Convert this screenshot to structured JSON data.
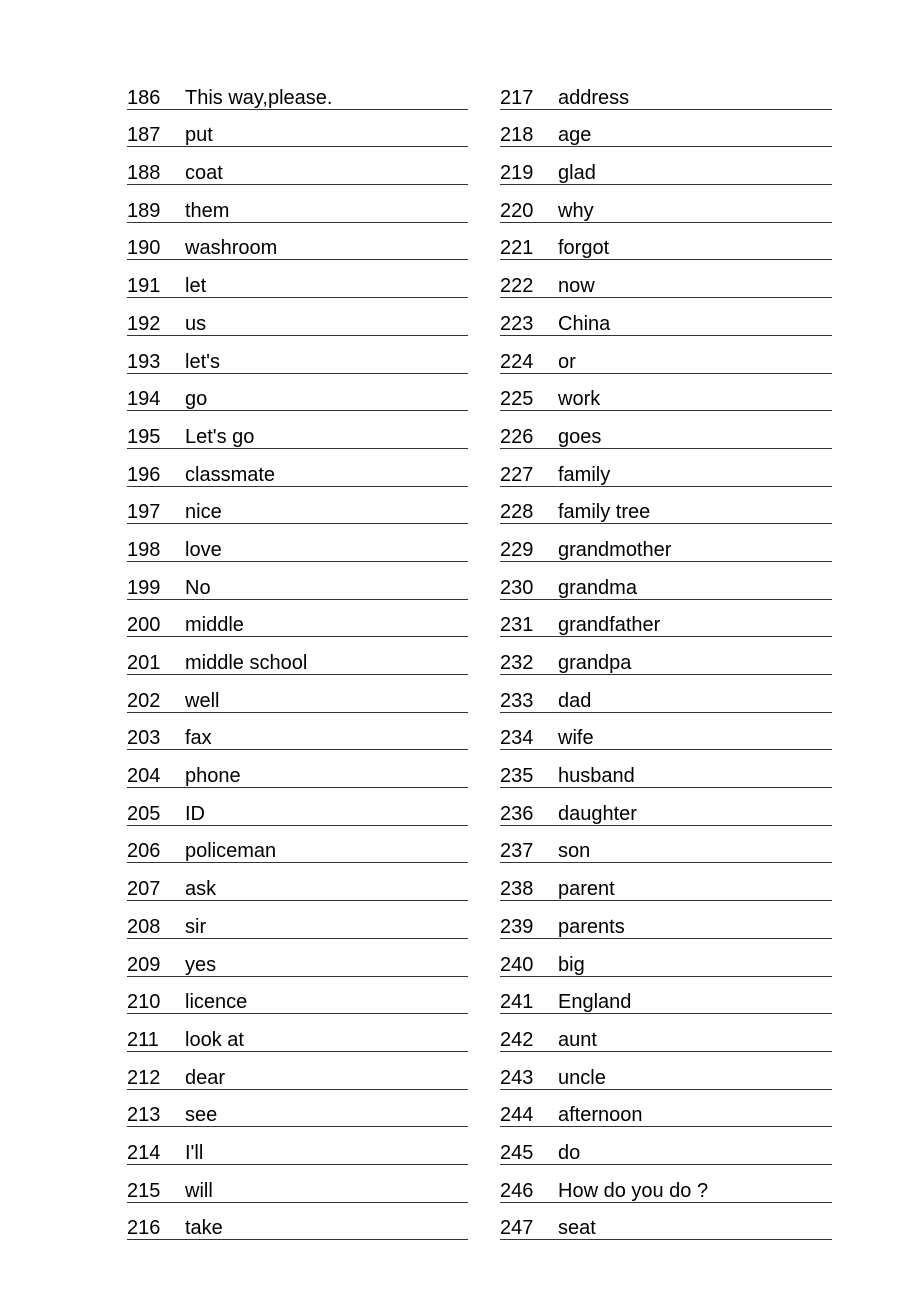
{
  "left_column": [
    {
      "num": "186",
      "word": "This way,please."
    },
    {
      "num": "187",
      "word": "put"
    },
    {
      "num": "188",
      "word": "coat"
    },
    {
      "num": "189",
      "word": "them"
    },
    {
      "num": "190",
      "word": "washroom"
    },
    {
      "num": "191",
      "word": "let"
    },
    {
      "num": "192",
      "word": "us"
    },
    {
      "num": "193",
      "word": "let's"
    },
    {
      "num": "194",
      "word": "go"
    },
    {
      "num": "195",
      "word": "Let's go"
    },
    {
      "num": "196",
      "word": "classmate"
    },
    {
      "num": "197",
      "word": "nice"
    },
    {
      "num": "198",
      "word": "love"
    },
    {
      "num": "199",
      "word": "No"
    },
    {
      "num": "200",
      "word": "middle"
    },
    {
      "num": "201",
      "word": "middle school"
    },
    {
      "num": "202",
      "word": "well"
    },
    {
      "num": "203",
      "word": "fax"
    },
    {
      "num": "204",
      "word": "phone"
    },
    {
      "num": "205",
      "word": "ID"
    },
    {
      "num": "206",
      "word": "policeman"
    },
    {
      "num": "207",
      "word": "ask"
    },
    {
      "num": "208",
      "word": "sir"
    },
    {
      "num": "209",
      "word": "yes"
    },
    {
      "num": "210",
      "word": "licence"
    },
    {
      "num": "211",
      "word": "look at"
    },
    {
      "num": "212",
      "word": "dear"
    },
    {
      "num": "213",
      "word": "see"
    },
    {
      "num": "214",
      "word": "I'll"
    },
    {
      "num": "215",
      "word": "will"
    },
    {
      "num": "216",
      "word": "take"
    }
  ],
  "right_column": [
    {
      "num": "217",
      "word": "address"
    },
    {
      "num": "218",
      "word": "age"
    },
    {
      "num": "219",
      "word": "glad"
    },
    {
      "num": "220",
      "word": "why"
    },
    {
      "num": "221",
      "word": "forgot"
    },
    {
      "num": "222",
      "word": "now"
    },
    {
      "num": "223",
      "word": "China"
    },
    {
      "num": "224",
      "word": "or"
    },
    {
      "num": "225",
      "word": "work"
    },
    {
      "num": "226",
      "word": "goes"
    },
    {
      "num": "227",
      "word": "family"
    },
    {
      "num": "228",
      "word": "family tree"
    },
    {
      "num": "229",
      "word": "grandmother"
    },
    {
      "num": "230",
      "word": "grandma"
    },
    {
      "num": "231",
      "word": "grandfather"
    },
    {
      "num": "232",
      "word": "grandpa"
    },
    {
      "num": "233",
      "word": "dad"
    },
    {
      "num": "234",
      "word": "wife"
    },
    {
      "num": "235",
      "word": "husband"
    },
    {
      "num": "236",
      "word": "daughter"
    },
    {
      "num": "237",
      "word": "son"
    },
    {
      "num": "238",
      "word": "parent"
    },
    {
      "num": "239",
      "word": "parents"
    },
    {
      "num": "240",
      "word": "big"
    },
    {
      "num": "241",
      "word": "England"
    },
    {
      "num": "242",
      "word": "aunt"
    },
    {
      "num": "243",
      "word": "uncle"
    },
    {
      "num": "244",
      "word": "afternoon"
    },
    {
      "num": "245",
      "word": "do"
    },
    {
      "num": "246",
      "word": "How do you do ?"
    },
    {
      "num": "247",
      "word": "seat"
    }
  ]
}
